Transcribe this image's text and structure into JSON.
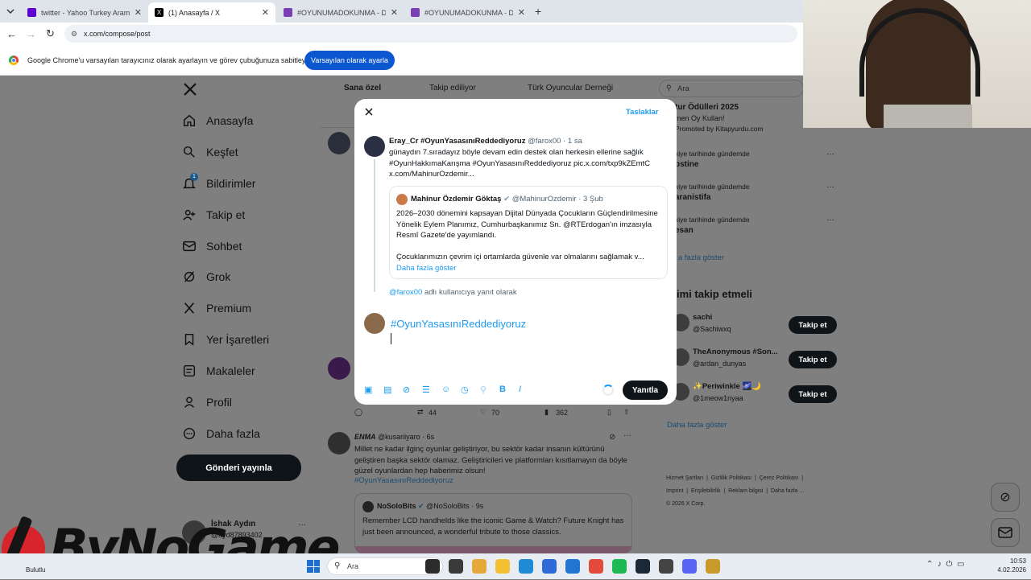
{
  "browser": {
    "tabs": [
      {
        "title": "twitter - Yahoo Turkey Arama Sonuçları",
        "active": false,
        "fav_color": "#6001d2"
      },
      {
        "title": "(1) Anasayfa / X",
        "active": true,
        "fav_color": "#000000"
      },
      {
        "title": "#OYUNUMADOKUNMA - Dijital Ödeme",
        "active": false,
        "fav_color": "#7b3fb5"
      },
      {
        "title": "#OYUNUMADOKUNMA - Dijital Ödeme",
        "active": false,
        "fav_color": "#7b3fb5"
      }
    ],
    "url": "x.com/compose/post",
    "infobar_text": "Google Chrome'u varsayılan tarayıcınız olarak ayarlayın ve görev çubuğunuza sabitleyin",
    "infobar_button": "Varsayılan olarak ayarla"
  },
  "sidebar": {
    "items": [
      {
        "label": "Anasayfa",
        "icon": "home-icon"
      },
      {
        "label": "Keşfet",
        "icon": "search-icon"
      },
      {
        "label": "Bildirimler",
        "icon": "bell-icon",
        "badge": "1"
      },
      {
        "label": "Takip et",
        "icon": "follow-icon"
      },
      {
        "label": "Sohbet",
        "icon": "mail-icon"
      },
      {
        "label": "Grok",
        "icon": "grok-icon"
      },
      {
        "label": "Premium",
        "icon": "x-logo-icon"
      },
      {
        "label": "Yer İşaretleri",
        "icon": "bookmark-icon"
      },
      {
        "label": "Makaleler",
        "icon": "article-icon"
      },
      {
        "label": "Profil",
        "icon": "profile-icon"
      },
      {
        "label": "Daha fazla",
        "icon": "more-icon"
      }
    ],
    "post_button": "Gönderi yayınla",
    "account_name": "İshak Aydın",
    "account_handle": "@ayd87893402"
  },
  "feed": {
    "tabs": [
      "Sana özel",
      "Takip ediliyor",
      "Türk Oyuncular Derneği"
    ],
    "stats": {
      "retweets": "44",
      "likes": "70",
      "views": "362"
    },
    "post2": {
      "name": "ENMA",
      "handle": "@kusariiyaro",
      "time": "6s",
      "text": "Millet ne kadar ilginç oyunlar geliştiriyor, bu sektör kadar insanın kültürünü geliştiren başka sektör olamaz. Geliştiricileri ve platformları kısıtlamayın da böyle güzel oyunlardan hep haberimiz olsun!",
      "hashtag": "#OyunYasasınıReddediyoruz",
      "quote_name": "NoSoloBits",
      "quote_handle": "@NoSoloBits",
      "quote_time": "9s",
      "quote_text": "Remember LCD handhelds like the iconic Game & Watch? Future Knight has just been announced, a wonderful tribute to those classics."
    }
  },
  "right": {
    "search_placeholder": "Ara",
    "trend_items": [
      {
        "top": "tur Ödülleri 2025",
        "sub": "men Oy Kullan!",
        "extra": "Promoted by Kitapyurdu.com"
      },
      {
        "top": "kiye tarihinde gündemde",
        "sub": "pstine"
      },
      {
        "top": "kiye tarihinde gündemde",
        "sub": "aranistifa"
      },
      {
        "top": "kiye tarihinde gündemde",
        "sub": "esan"
      }
    ],
    "show_more": "a fazla göster",
    "who_to_follow_title": "imi takip etmeli",
    "follow_suggestions": [
      {
        "name": "sachi",
        "handle": "@Sachiwxq"
      },
      {
        "name": "TheAnonymous #Son...",
        "handle": "@ardan_dunyas"
      },
      {
        "name": "✨Periwinkle 🌌🌙",
        "handle": "@1meow1nyaa"
      }
    ],
    "follow_label": "Takip et",
    "show_more2": "Daha fazla göster",
    "footer": [
      "Hizmet Şartları",
      "Gizlilik Politikası",
      "Çerez Politikası",
      "Imprint",
      "Erişilebilirlik",
      "Reklam bilgisi",
      "Daha fazla ...",
      "© 2026 X Corp."
    ]
  },
  "modal": {
    "drafts_label": "Taslaklar",
    "original": {
      "name": "Eray_Cr #OyunYasasınıReddediyoruz",
      "handle": "@farox00",
      "time": "1 sa",
      "text": "günaydın 7.sıradayız böyle devam edin destek olan herkesin ellerine sağlık #OyunHakkımaKarışma #OyunYasasınıReddediyoruz pic.x.com/txp9kZEmtC x.com/MahinurOzdemir..."
    },
    "quoted": {
      "name": "Mahinur Özdemir Göktaş",
      "handle": "@MahinurOzdemir",
      "time": "3 Şub",
      "text1": "2026–2030 dönemini kapsayan Dijital Dünyada Çocukların Güçlendirilmesine Yönelik Eylem Planımız, Cumhurbaşkanımız Sn. @RTErdogan'ın imzasıyla Resmî Gazete'de yayımlandı.",
      "text2": "Çocuklarımızın çevrim içi ortamlarda güvenle var olmalarını sağlamak v...",
      "show_more": "Daha fazla göster"
    },
    "reply_to_handle": "@farox00",
    "reply_to_text": "adlı kullanıcıya yanıt olarak",
    "draft_text": "#OyunYasasınıReddediyoruz",
    "reply_button": "Yanıtla"
  },
  "overlay": {
    "logo_text": "ByNoGame",
    "weather": "Bulutlu"
  },
  "taskbar": {
    "search_placeholder": "Ara",
    "time": "10:53",
    "date": "4.02.2026"
  }
}
